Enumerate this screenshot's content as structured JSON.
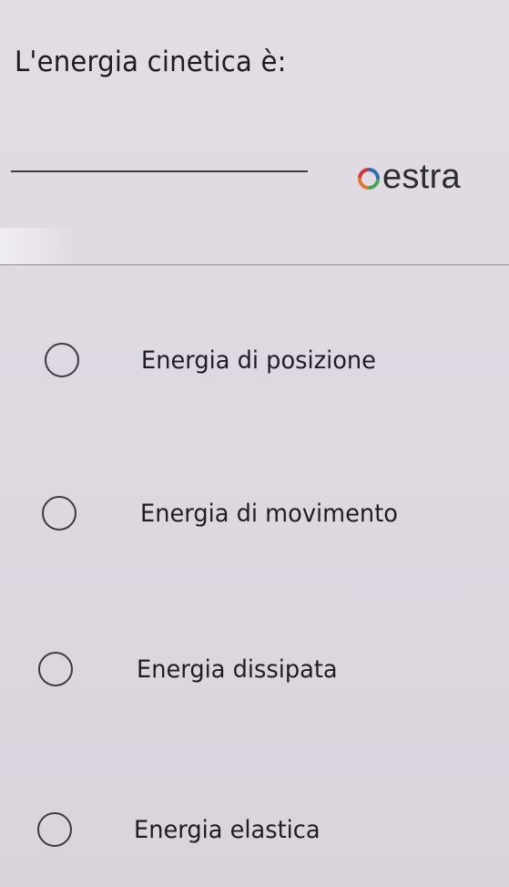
{
  "question": {
    "text": "L'energia cinetica è:"
  },
  "brand": {
    "name": "estra",
    "icon": "estra-logo-ring"
  },
  "options": [
    {
      "label": "Energia di posizione",
      "selected": false
    },
    {
      "label": "Energia di movimento",
      "selected": false
    },
    {
      "label": "Energia dissipata",
      "selected": false
    },
    {
      "label": "Energia elastica",
      "selected": false
    }
  ],
  "colors": {
    "background": "#dfd9e2",
    "text": "#1e1c22",
    "logo_blue": "#2f6db5",
    "logo_orange": "#e2782b",
    "logo_green": "#4aa35a",
    "logo_red": "#c8373d"
  }
}
